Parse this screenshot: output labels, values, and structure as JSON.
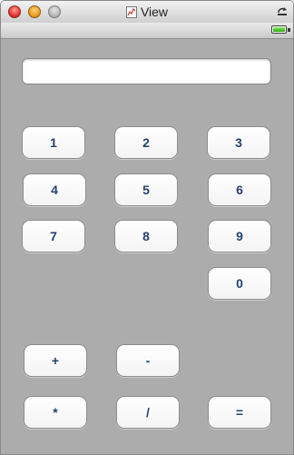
{
  "window": {
    "title": "View",
    "document_icon": "graph-document-icon",
    "resize_icon": "window-resize-icon",
    "battery_icon": "battery-full-icon"
  },
  "calculator": {
    "display_value": "",
    "keys": {
      "one": "1",
      "two": "2",
      "three": "3",
      "four": "4",
      "five": "5",
      "six": "6",
      "seven": "7",
      "eight": "8",
      "nine": "9",
      "zero": "0",
      "plus": "+",
      "minus": "-",
      "multiply": "*",
      "divide": "/",
      "equals": "="
    }
  },
  "colors": {
    "content_background": "#acacac",
    "key_text": "#27416f",
    "battery_fill": "#29a10f"
  }
}
